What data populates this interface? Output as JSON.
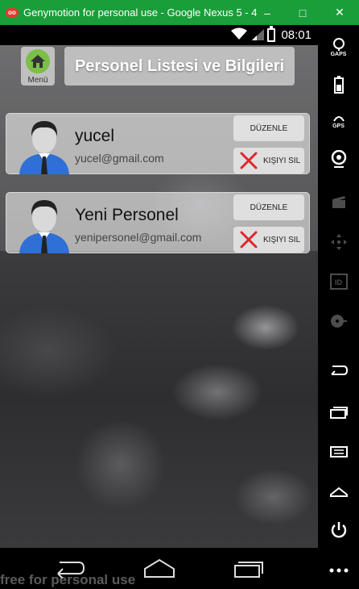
{
  "window": {
    "title": "Genymotion for personal use - Google Nexus 5 - 4...",
    "icon_text": "oo",
    "minimize": "–",
    "maximize": "□",
    "close": "✕"
  },
  "status_bar": {
    "time": "08:01"
  },
  "header": {
    "menu_label": "Menü",
    "title": "Personel Listesi ve Bilgileri"
  },
  "personnel": [
    {
      "name": "yucel",
      "email": "yucel@gmail.com",
      "edit_label": "DÜZENLE",
      "delete_label": "KIŞIYI SIL"
    },
    {
      "name": "Yeni Personel",
      "email": "yenipersonel@gmail.com",
      "edit_label": "DÜZENLE",
      "delete_label": "KIŞIYI SIL"
    }
  ],
  "watermark": "free for personal use",
  "toolbar": {
    "gaps_label": "GAPS",
    "gps_label": "GPS",
    "id_label": "ID"
  },
  "colors": {
    "titlebar": "#1a9e3a",
    "home_icon": "#7bbf45",
    "delete_x": "#e0262a",
    "avatar_shirt": "#2f6fd6"
  }
}
